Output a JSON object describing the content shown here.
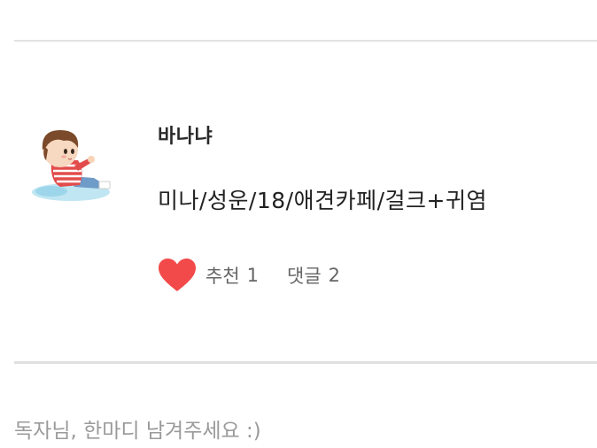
{
  "post": {
    "author": "바나냐",
    "title": "미나/성운/18/애견카페/걸크+귀염",
    "recommend_label": "추천",
    "recommend_count": "1",
    "comment_label": "댓글",
    "comment_count": "2",
    "avatar_icon": "chibi-character-avatar",
    "heart_icon": "heart-icon",
    "heart_color": "#f24a4a"
  },
  "comment_box": {
    "placeholder": "독자님, 한마디 남겨주세요 :)"
  }
}
